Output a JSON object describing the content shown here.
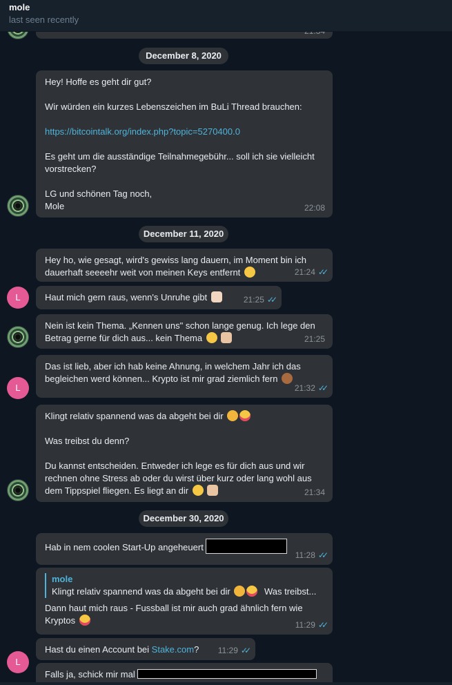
{
  "header": {
    "name": "mole",
    "status": "last seen recently"
  },
  "top_partial_time": "21:34",
  "dates": [
    "December 8, 2020",
    "December 11, 2020",
    "December 30, 2020"
  ],
  "messages": [
    {
      "line1": "Hey! Hoffe es geht dir gut?",
      "line2": "Wir würden ein kurzes Lebenszeichen im BuLi Thread brauchen:",
      "link": "https://bitcointalk.org/index.php?topic=5270400.0",
      "line3a": "Es geht um die ausständige Teilnahmegebühr... soll ich sie vielleicht",
      "line3b": "vorstrecken?",
      "line4a": "LG und schönen Tag noch,",
      "line4b": "Mole",
      "time": "22:08"
    },
    {
      "line1": "Hey ho, wie gesagt, wird's gewiss lang dauern, im Moment bin ich",
      "line2": "dauerhaft seeeehr weit von meinen Keys entfernt",
      "time": "21:24"
    },
    {
      "line1": "Haut mich gern raus, wenn's Unruhe gibt",
      "time": "21:25"
    },
    {
      "line1": "Nein ist kein Thema. „Kennen uns\" schon lange genug. Ich lege den",
      "line2": "Betrag gerne für dich aus... kein Thema",
      "time": "21:25"
    },
    {
      "line1": "Das ist lieb, aber ich hab keine Ahnung, in welchem Jahr ich das",
      "line2": "begleichen werd können... Krypto ist mir grad ziemlich fern",
      "time": "21:32"
    },
    {
      "line1": "Klingt relativ spannend was da abgeht bei dir",
      "line2": "Was treibst du denn?",
      "line3a": "Du kannst entscheiden. Entweder ich lege es für dich aus und wir",
      "line3b": "rechnen ohne Stress ab oder du wirst über kurz oder lang wohl aus",
      "line3c": "dem Tippspiel fliegen. Es liegt an dir",
      "time": "21:34"
    },
    {
      "line1": "Hab in nem coolen Start-Up angeheuert",
      "time": "11:28"
    },
    {
      "quote_name": "mole",
      "quote_text": "Klingt relativ spannend was da abgeht bei dir",
      "quote_tail": "Was treibst...",
      "line1": "Dann haut mich raus - Fussball ist mir auch grad ähnlich fern wie",
      "line2": "Kryptos",
      "time": "11:29"
    },
    {
      "line1a": "Hast du einen Account bei ",
      "link": "Stake.com",
      "line1b": "?",
      "time": "11:29"
    },
    {
      "line1": "Falls ja, schick mir mal"
    }
  ],
  "avatar_letter": "L",
  "colors": {
    "accent": "#4fb3d9",
    "bubble": "#2f3338",
    "background": "#0e1621",
    "avatar_l": "#e55a95"
  }
}
